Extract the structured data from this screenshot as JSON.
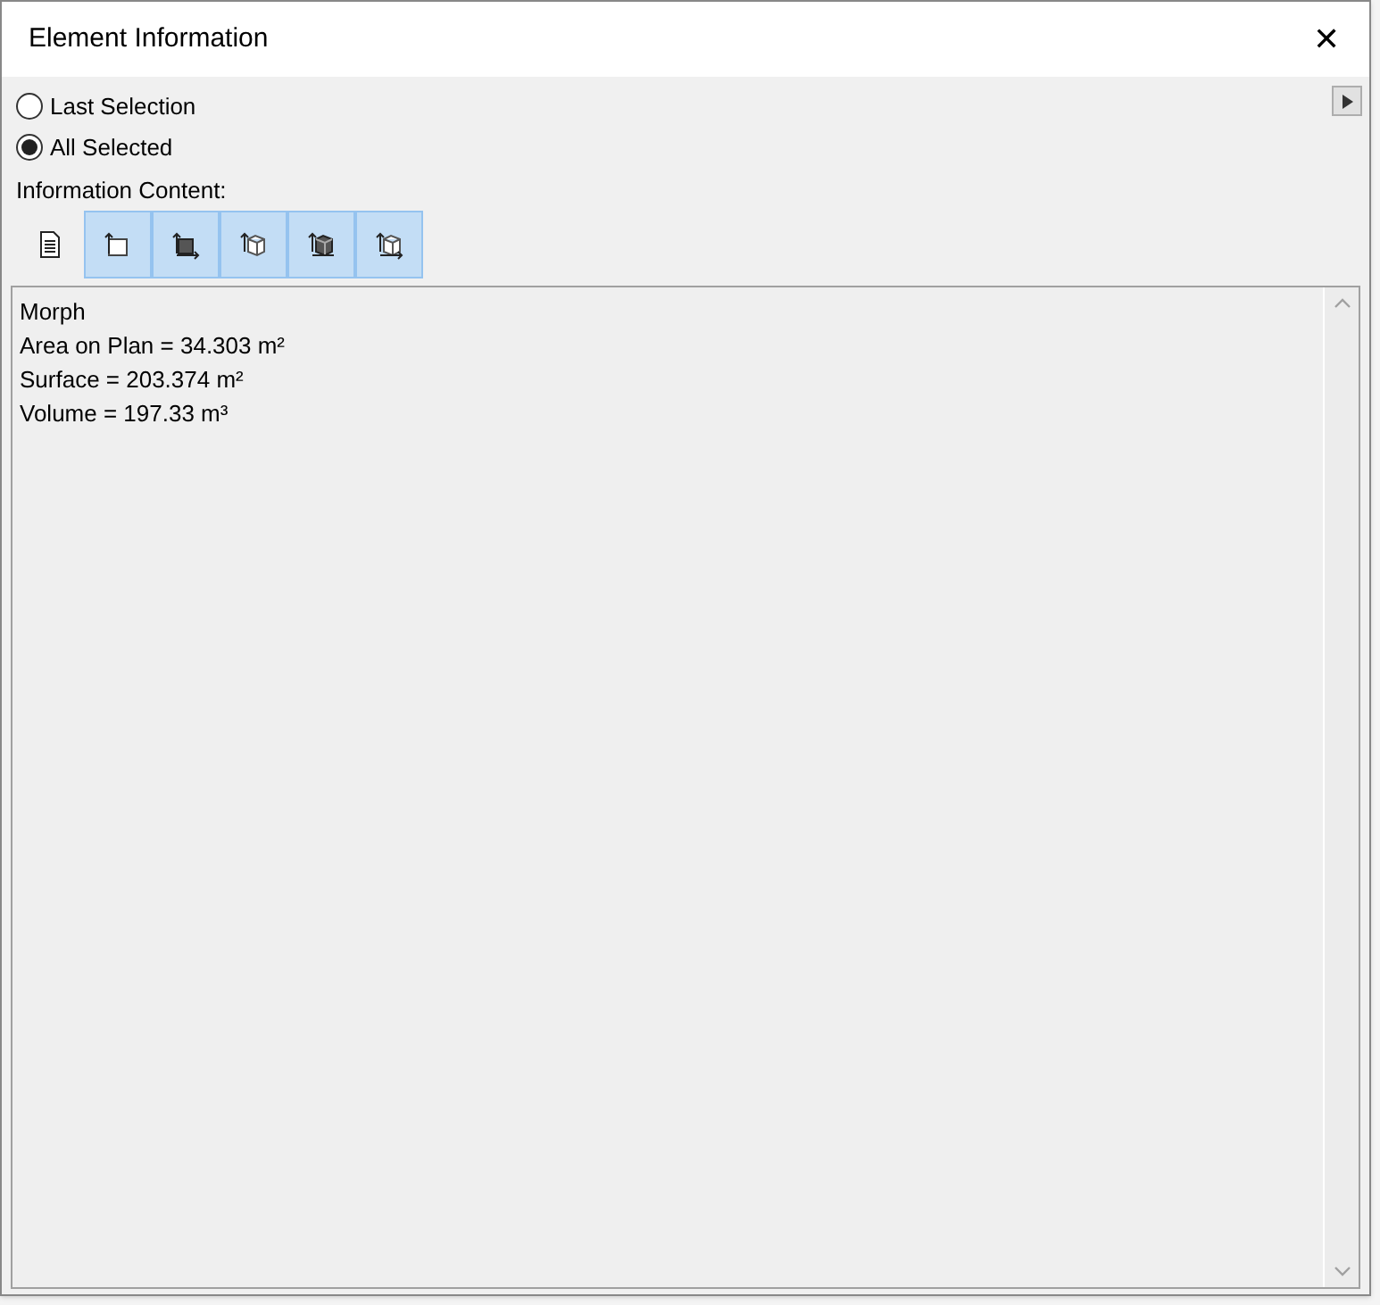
{
  "window": {
    "title": "Element Information",
    "close": "✕"
  },
  "scope": [
    {
      "label": "Last Selection",
      "selected": false
    },
    {
      "label": "All Selected",
      "selected": true
    }
  ],
  "content_label": "Information Content:",
  "content_buttons": [
    {
      "kind": "document",
      "selected": false
    },
    {
      "kind": "plan",
      "selected": true
    },
    {
      "kind": "plan-filled",
      "selected": true
    },
    {
      "kind": "box",
      "selected": true
    },
    {
      "kind": "box-filled",
      "selected": true
    },
    {
      "kind": "box-arrow",
      "selected": true
    }
  ],
  "info_lines": [
    "Morph",
    "Area on Plan = 34.303 m²",
    "Surface = 203.374 m²",
    "Volume = 197.33 m³"
  ]
}
